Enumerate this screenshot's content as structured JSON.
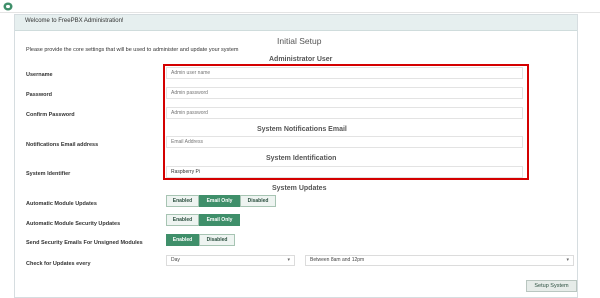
{
  "header_text": "Welcome to FreePBX Administration!",
  "title": "Initial Setup",
  "intro": "Please provide the core settings that will be used to administer and update your system",
  "sections": {
    "admin_user": "Administrator User",
    "notifications": "System Notifications Email",
    "identification": "System Identification",
    "updates": "System Updates"
  },
  "labels": {
    "username": "Username",
    "password": "Password",
    "confirm_password": "Confirm Password",
    "notifications_email": "Notifications Email address",
    "system_identifier": "System Identifier",
    "auto_module_updates": "Automatic Module Updates",
    "auto_security_updates": "Automatic Module Security Updates",
    "send_security_emails": "Send Security Emails For Unsigned Modules",
    "check_updates": "Check for Updates every"
  },
  "fields": {
    "username_placeholder": "Admin user name",
    "password_placeholder": "Admin password",
    "confirm_placeholder": "Admin password",
    "email_placeholder": "Email Address",
    "system_identifier_value": "Raspberry Pi"
  },
  "toggles": {
    "enabled": "Enabled",
    "email_only": "Email Only",
    "disabled": "Disabled"
  },
  "selects": {
    "frequency": "Day",
    "window": "Between 8am and 12pm"
  },
  "setup_button": "Setup System",
  "colors": {
    "accent": "#3f8f6a",
    "highlight_border": "#d40000",
    "header_bg": "#e6efef"
  }
}
